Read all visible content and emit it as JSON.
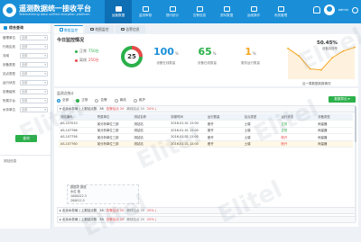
{
  "app": {
    "title": "遥测数据统一接收平台",
    "subtitle": "Telemetering data unified reception platform"
  },
  "nav": {
    "items": [
      {
        "label": "运营数据",
        "active": true
      },
      {
        "label": "监测审核",
        "active": false
      },
      {
        "label": "提问统计",
        "active": false
      },
      {
        "label": "告警信息",
        "active": false
      },
      {
        "label": "资料数据",
        "active": false
      },
      {
        "label": "运维操作",
        "active": false
      },
      {
        "label": "系统管理",
        "active": false
      }
    ],
    "user": "admin"
  },
  "sidebar": {
    "title": "综合查询",
    "filters": [
      {
        "label": "管理单位",
        "value": "全部"
      },
      {
        "label": "行政区划",
        "value": "全部"
      },
      {
        "label": "流域",
        "value": "全部"
      },
      {
        "label": "设备类型",
        "value": "全部"
      },
      {
        "label": "站点类型",
        "value": "全部"
      },
      {
        "label": "运行状态",
        "value": "全部"
      },
      {
        "label": "告警级别",
        "value": "全部"
      },
      {
        "label": "所属平台",
        "value": "全部"
      },
      {
        "label": "水务单位",
        "value": "全部"
      }
    ],
    "query_button": "查询",
    "footer_label": "测站信息"
  },
  "tabs": [
    {
      "label": "数据监控",
      "active": true
    },
    {
      "label": "地图监控",
      "active": false
    },
    {
      "label": "告警信息",
      "active": false
    }
  ],
  "overview": {
    "title": "今日监控情况",
    "donut": {
      "center_label": "25",
      "online": 750,
      "offline": 250
    },
    "legend": [
      {
        "label": "正常",
        "value": "750台",
        "type": "online"
      },
      {
        "label": "离线",
        "value": "250台",
        "type": "offline"
      }
    ],
    "stats": [
      {
        "value": "100",
        "unit": "%",
        "label": "设备在线数量",
        "color": "#1a8fd8"
      },
      {
        "value": "65",
        "unit": "%",
        "label": "设备在线数量",
        "color": "#2bb04a"
      },
      {
        "value": "1",
        "unit": "%",
        "label": "服务运行数量",
        "color": "#f5a623"
      }
    ],
    "trend": {
      "percent": "50.45%",
      "percent_sub": "设备到报率",
      "label": "近一周数据到报情况",
      "values": [
        60,
        45,
        20,
        18,
        42,
        55,
        62
      ]
    }
  },
  "panel": {
    "header": "监测点统计",
    "radios": [
      {
        "label": "全部",
        "state": "checked"
      },
      {
        "label": "正常",
        "state": "green"
      },
      {
        "label": "告警",
        "state": "none"
      },
      {
        "label": "离线",
        "state": "none"
      },
      {
        "label": "维护",
        "state": "none"
      }
    ],
    "export_button": "数据导出 ▾",
    "groups": [
      {
        "name": "▾ 北京水务局 | 上报站点数 ",
        "count": "38",
        "alarm": "告警站点 20",
        "off": "离线站点 20",
        "pct": "20% |"
      },
      {
        "name": "▸ 北京水务局 | 上报站点数 ",
        "count": "38",
        "alarm": "告警站点 20",
        "off": "离线站点 20",
        "pct": "20% |"
      },
      {
        "name": "▸ 北京水务局 | 上报站点数 ",
        "count": "38",
        "alarm": "告警站点 20",
        "off": "离线站点 20",
        "pct": "20% |"
      },
      {
        "name": "▸ 北京水务局 | 上报站点数 ",
        "count": "38",
        "alarm": "告警站点 20",
        "off": "离线站点 20",
        "pct": "20% |"
      },
      {
        "name": "▸ 北京水务局 | 上报站点数 ",
        "count": "38",
        "alarm": "告警站点 20",
        "off": "离线站点 20",
        "pct": "20% |"
      }
    ],
    "table": {
      "columns": [
        "测站编码",
        "所属单位",
        "测站名称",
        "到报时间",
        "运行数量",
        "站点类型",
        "运行状态",
        "设备类型"
      ],
      "rows": [
        [
          "AS-107010",
          "某分析单位三部",
          "测站站",
          "2016-01-01 12:00",
          "断开",
          "土壤",
          "正常",
          "雨量器"
        ],
        [
          "AS-107766",
          "某分析单位三部",
          "测站站",
          "2016-01-01 12:00",
          "断开",
          "土壤",
          "正常",
          "雨量器"
        ],
        [
          "AS-107756",
          "某分析单位三部",
          "测站站",
          "2016-01-01 12:00",
          "断开",
          "土壤",
          "断开",
          "雨量器"
        ],
        [
          "AS-107760",
          "某分析单位三部",
          "测站站",
          "2016-01-01 12:00",
          "断开",
          "土壤",
          "断开",
          "雨量器"
        ]
      ],
      "sub_rows": [
        "数据项 数值",
        "水位 值",
        "1000022.3",
        "200012.5"
      ]
    }
  },
  "watermark": "Elitel"
}
